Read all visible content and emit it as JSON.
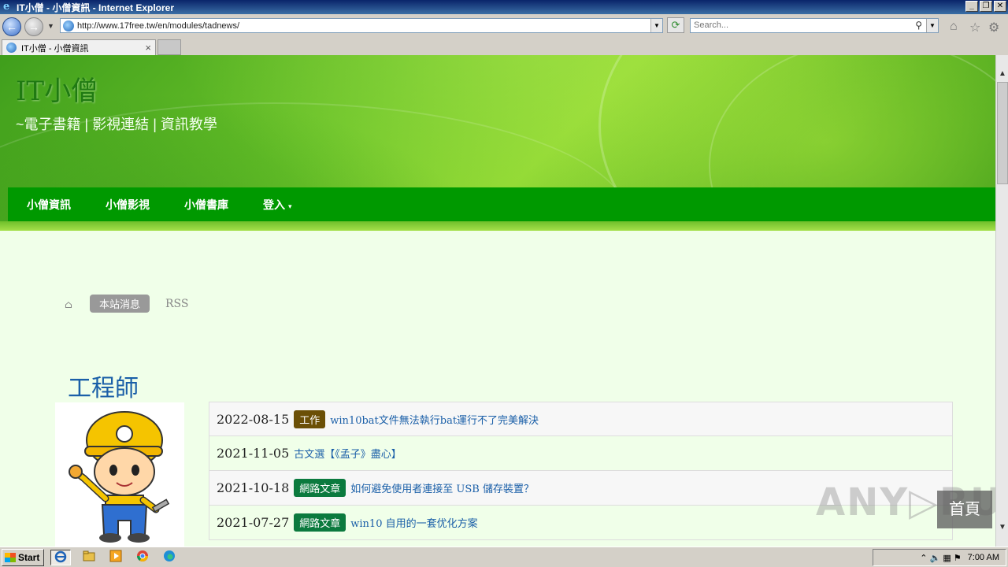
{
  "window": {
    "title": "IT小僧 - 小僧資訊 - Internet Explorer",
    "ie_logo": "e",
    "controls": {
      "minimize": "_",
      "restore": "❐",
      "close": "✕"
    }
  },
  "toolbar": {
    "back": "←",
    "forward": "→",
    "nav_dropdown": "▼",
    "address": "http://www.17free.tw/en/modules/tadnews/",
    "address_dropdown": "▼",
    "refresh": "⟳",
    "search_placeholder": "Search...",
    "search_icon": "⚲",
    "search_dropdown": "▼",
    "home_icon": "⌂",
    "favorites_icon": "☆",
    "tools_icon": "⚙"
  },
  "tabs": [
    {
      "label": "IT小僧 - 小僧資訊",
      "close": "×"
    }
  ],
  "site": {
    "title": "IT小僧",
    "subtitle": "~電子書籍 | 影視連結 | 資訊教學"
  },
  "nav": {
    "items": [
      "小僧資訊",
      "小僧影視",
      "小僧書庫"
    ],
    "login": "登入",
    "caret": "▾"
  },
  "breadcrumb": {
    "home_icon": "⌂",
    "active": "本站消息",
    "rss": "RSS"
  },
  "section": {
    "title": "工程師"
  },
  "news": [
    {
      "date": "2022-08-15",
      "tag": "工作",
      "tag_color": "#6b4f06",
      "title": "win10bat文件無法執行bat運行不了完美解決"
    },
    {
      "date": "2021-11-05",
      "tag": "",
      "tag_color": "",
      "title": "古文選【《孟子》盡心】"
    },
    {
      "date": "2021-10-18",
      "tag": "網路文章",
      "tag_color": "#0b7a3e",
      "title": "如何避免使用者連接至 USB 儲存裝置？"
    },
    {
      "date": "2021-07-27",
      "tag": "網路文章",
      "tag_color": "#0b7a3e",
      "title": "win10 自用的一套优化方案"
    }
  ],
  "watermark": "ANY▷RUN",
  "go_top": "首頁",
  "scrollbar": {
    "up": "▲",
    "down": "▼"
  },
  "taskbar": {
    "start": "Start",
    "apps": [
      "ie-icon",
      "explorer-icon",
      "media-icon",
      "chrome-icon",
      "edge-icon"
    ],
    "tray_icons": "⌃ 🔈 ▦ ⚑",
    "clock": "7:00 AM"
  }
}
